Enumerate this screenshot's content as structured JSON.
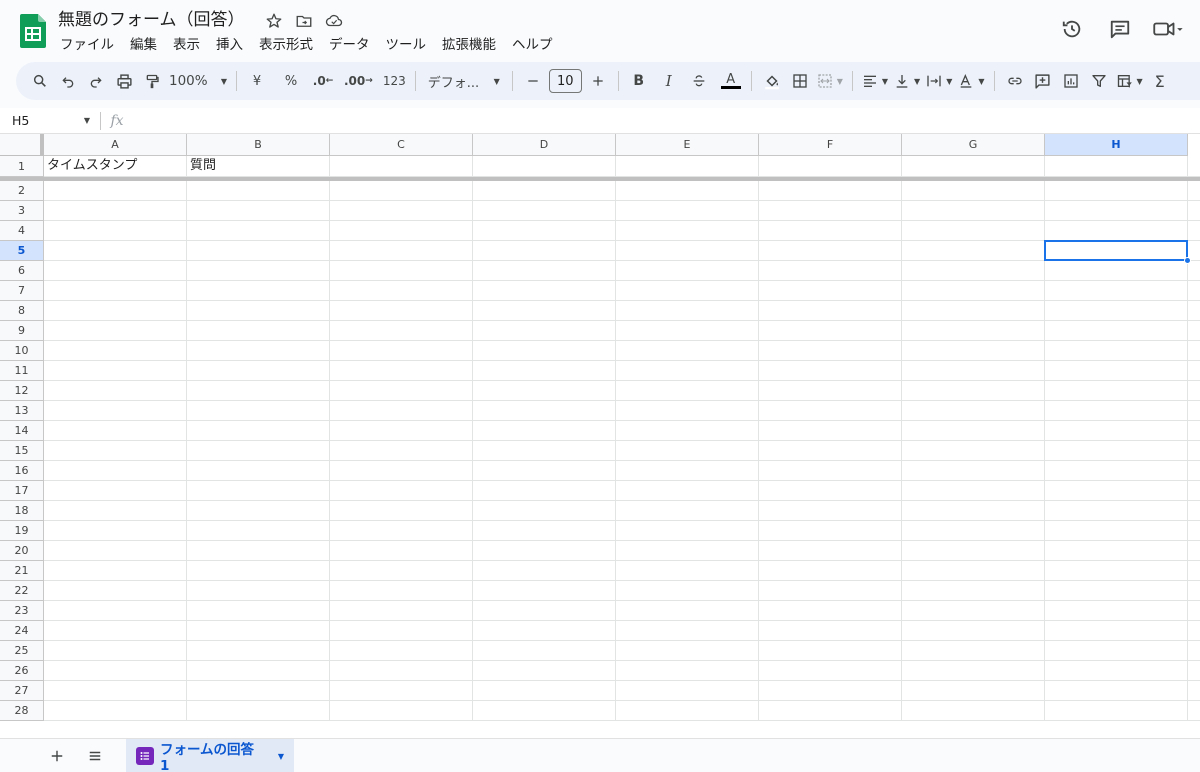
{
  "header": {
    "title": "無題のフォーム（回答）",
    "menu": [
      "ファイル",
      "編集",
      "表示",
      "挿入",
      "表示形式",
      "データ",
      "ツール",
      "拡張機能",
      "ヘルプ"
    ]
  },
  "toolbar": {
    "zoom": "100%",
    "currency": "¥",
    "percent": "%",
    "decimal_decrease": ".0",
    "decimal_increase": ".00",
    "number_format": "123",
    "font": "デフォ...",
    "font_size": "10",
    "bold": "B",
    "italic": "I",
    "text_color": "A"
  },
  "formula_bar": {
    "cell_ref": "H5",
    "fx": "fx",
    "value": ""
  },
  "grid": {
    "columns": [
      "A",
      "B",
      "C",
      "D",
      "E",
      "F",
      "G",
      "H"
    ],
    "selected_column": "H",
    "selected_row": 5,
    "row_count": 28,
    "cells": {
      "A1": "タイムスタンプ",
      "B1": "質問"
    }
  },
  "sheets": {
    "tabs": [
      {
        "label": "フォームの回答 1",
        "active": true
      }
    ]
  },
  "colors": {
    "accent": "#1a73e8",
    "sheets_green": "#0f9d58",
    "forms_purple": "#7627bb"
  }
}
